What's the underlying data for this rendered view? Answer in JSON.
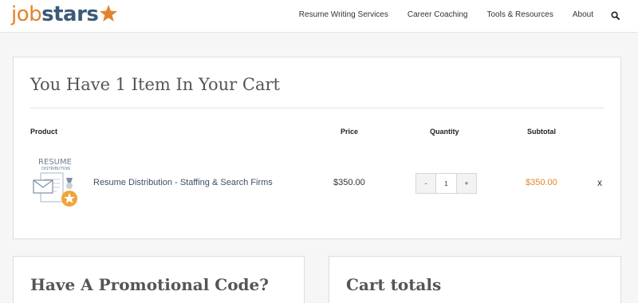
{
  "header": {
    "logo": {
      "part1": "job",
      "part2": "stars"
    },
    "nav": [
      {
        "label": "Resume Writing Services"
      },
      {
        "label": "Career Coaching"
      },
      {
        "label": "Tools & Resources"
      },
      {
        "label": "About"
      }
    ],
    "search_icon": "search-icon"
  },
  "cart": {
    "title": "You Have 1 Item In Your Cart",
    "columns": {
      "product": "Product",
      "price": "Price",
      "quantity": "Quantity",
      "subtotal": "Subtotal"
    },
    "items": [
      {
        "name": "Resume Distribution - Staffing & Search Firms",
        "price": "$350.00",
        "quantity": "1",
        "subtotal": "$350.00",
        "remove_label": "x",
        "thumb_text_1": "RESUME",
        "thumb_text_2": "DISTRIBUTION"
      }
    ],
    "qty_minus": "-",
    "qty_plus": "+"
  },
  "promo": {
    "title": "Have A Promotional Code?"
  },
  "totals": {
    "title": "Cart totals"
  },
  "colors": {
    "accent": "#e0852e",
    "brand_blue": "#3c5a78"
  }
}
